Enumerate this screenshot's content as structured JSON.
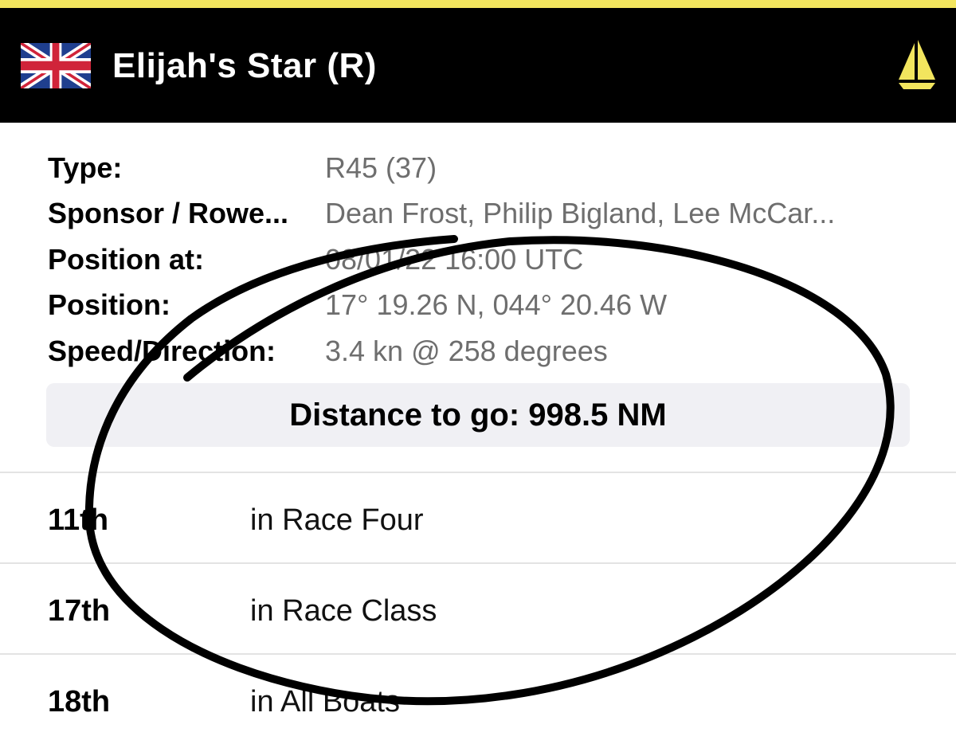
{
  "header": {
    "title": "Elijah's Star (R)",
    "flag_icon": "uk-flag-icon",
    "boat_icon": "sailboat-icon",
    "accent_color": "#f2e55e",
    "boat_icon_color": "#f2e55e"
  },
  "details": [
    {
      "label": "Type:",
      "value": "R45 (37)"
    },
    {
      "label": "Sponsor / Rowe...",
      "value": "Dean Frost, Philip Bigland, Lee McCar..."
    },
    {
      "label": "Position at:",
      "value": "08/01/22 16:00 UTC"
    },
    {
      "label": "Position:",
      "value": "17° 19.26 N, 044° 20.46 W"
    },
    {
      "label": "Speed/Direction:",
      "value": "3.4 kn @ 258 degrees"
    }
  ],
  "distance_to_go": "Distance to go: 998.5 NM",
  "rankings": [
    {
      "rank": "11th",
      "description": "in Race Four"
    },
    {
      "rank": "17th",
      "description": "in Race Class"
    },
    {
      "rank": "18th",
      "description": "in All Boats"
    }
  ]
}
